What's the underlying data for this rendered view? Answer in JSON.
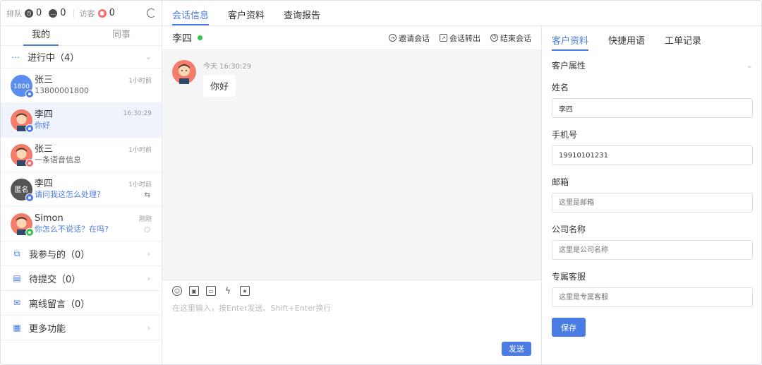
{
  "status": {
    "queue_label": "排队",
    "queue_count": "0",
    "chat_count": "0",
    "visitor_label": "访客",
    "visitor_count": "0"
  },
  "left_tabs": [
    "我的",
    "同事"
  ],
  "in_progress": {
    "label": "进行中（4）"
  },
  "conversations": [
    {
      "name": "张三",
      "message": "13800001800",
      "time": "1小时前",
      "avatar_text": "1800",
      "avatar_color": "#5b8def",
      "badge_color": "#4b7ce5"
    },
    {
      "name": "李四",
      "message": "你好",
      "time": "16:30:29",
      "avatar_text": "",
      "avatar_color": "#f47c6b",
      "badge_color": "#4b7ce5"
    },
    {
      "name": "张三",
      "message": "一条语音信息",
      "time": "1小时前",
      "avatar_text": "",
      "avatar_color": "#f47c6b",
      "badge_color": "#f56c6c"
    },
    {
      "name": "李四",
      "message": "请问我这怎么处理？",
      "time": "1小时前",
      "avatar_text": "匿名",
      "avatar_color": "#555555",
      "badge_color": "#4b7ce5"
    },
    {
      "name": "Simon",
      "message": "你怎么不说话？在吗?",
      "time": "刚刚",
      "avatar_text": "",
      "avatar_color": "#f47c6b",
      "badge_color": "#3ac24f"
    }
  ],
  "menus": [
    {
      "label": "我参与的（0）"
    },
    {
      "label": "待提交（0）"
    },
    {
      "label": "离线留言（0）"
    },
    {
      "label": "更多功能"
    }
  ],
  "top_tabs": [
    "会话信息",
    "客户资料",
    "查询报告"
  ],
  "chat": {
    "title": "李四",
    "actions": [
      "邀请会话",
      "会话转出",
      "结束会话"
    ],
    "message_time": "今天 16:30:29",
    "message_text": "你好",
    "input_placeholder": "在这里输入，按Enter发送、Shift+Enter换行",
    "send_label": "发送"
  },
  "right_tabs": [
    "客户资料",
    "快捷用语",
    "工单记录"
  ],
  "customer": {
    "section_title": "客户属性",
    "fields": [
      {
        "label": "姓名",
        "value": "李四",
        "placeholder": ""
      },
      {
        "label": "手机号",
        "value": "19910101231",
        "placeholder": ""
      },
      {
        "label": "邮箱",
        "value": "",
        "placeholder": "这里是邮箱"
      },
      {
        "label": "公司名称",
        "value": "",
        "placeholder": "这里是公司名称"
      },
      {
        "label": "专属客服",
        "value": "",
        "placeholder": "这里是专属客服"
      }
    ],
    "save_label": "保存"
  },
  "colors": {
    "accent": "#4b7ce5",
    "online": "#3ac24f",
    "alert": "#f56c6c"
  }
}
